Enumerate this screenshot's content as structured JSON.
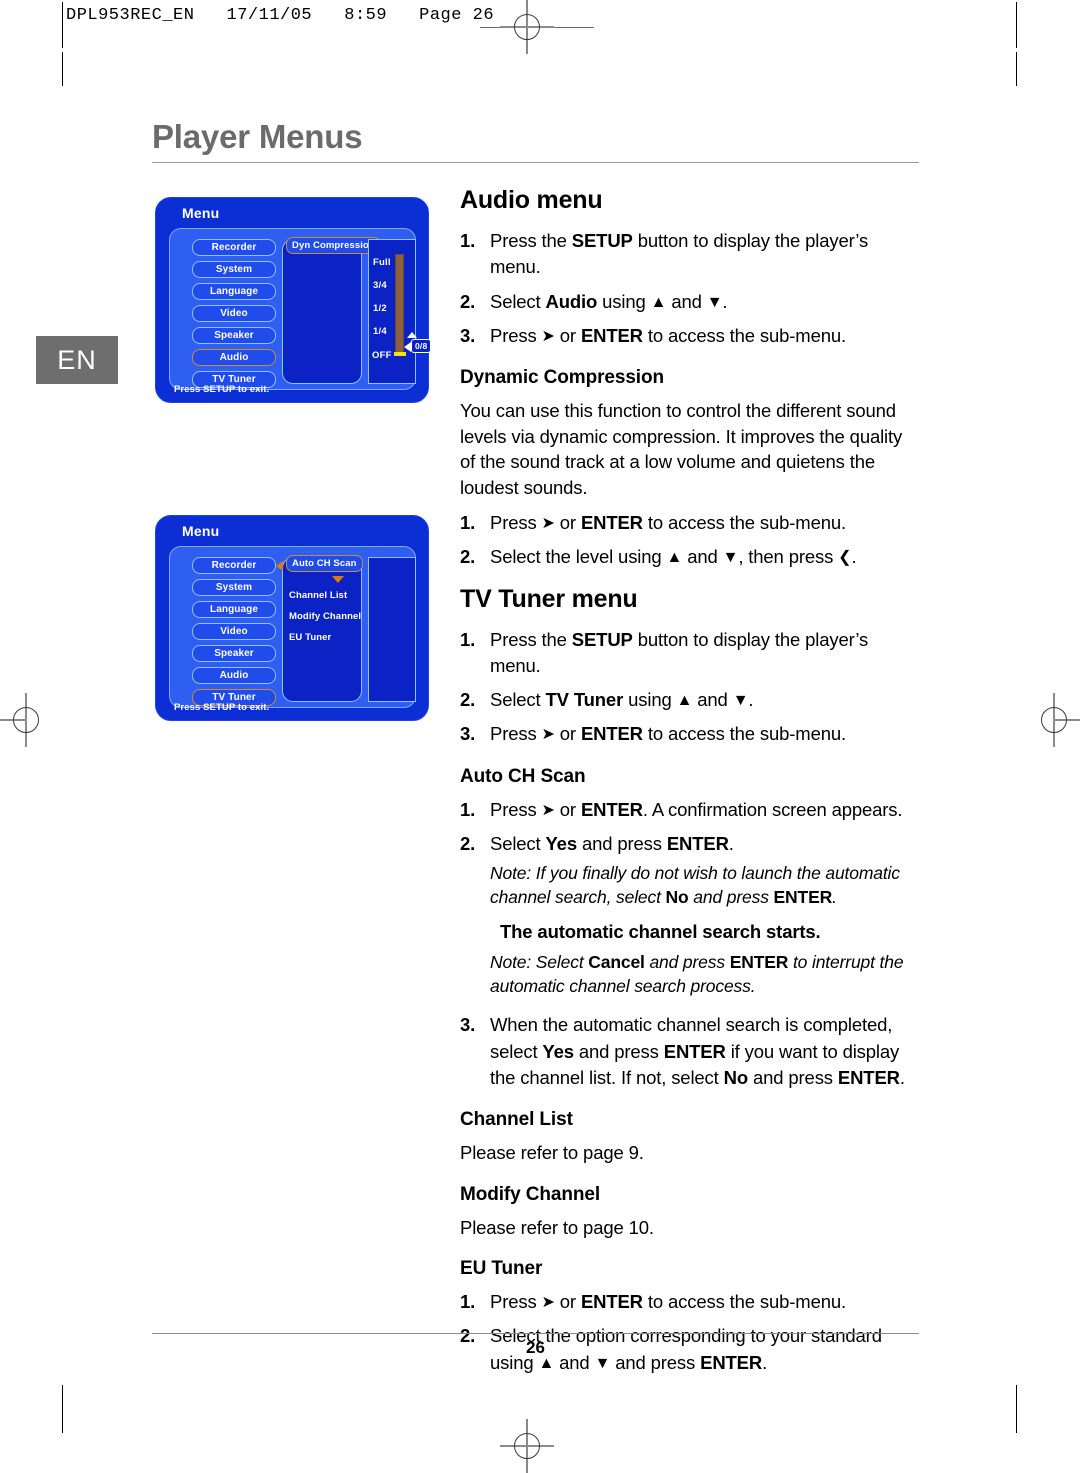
{
  "print_header": {
    "text": "DPL953REC_EN   17/11/05   8:59   Page 26"
  },
  "language_tab": {
    "label": "EN"
  },
  "page_title": "Player Menus",
  "folio": "26",
  "osd_audio": {
    "title": "Menu",
    "exit_hint": "Press SETUP to exit.",
    "nav_items": [
      {
        "label": "Recorder",
        "selected": false
      },
      {
        "label": "System",
        "selected": false
      },
      {
        "label": "Language",
        "selected": false
      },
      {
        "label": "Video",
        "selected": false
      },
      {
        "label": "Speaker",
        "selected": false
      },
      {
        "label": "Audio",
        "selected": true
      },
      {
        "label": "TV Tuner",
        "selected": false
      }
    ],
    "sub_items": [
      {
        "label": "Dyn Compression",
        "highlighted": true
      }
    ],
    "levels": [
      "Full",
      "3/4",
      "1/2",
      "1/4",
      "OFF"
    ],
    "value_badge": "0/8"
  },
  "osd_tuner": {
    "title": "Menu",
    "exit_hint": "Press SETUP to exit.",
    "nav_items": [
      {
        "label": "Recorder",
        "selected": false
      },
      {
        "label": "System",
        "selected": false
      },
      {
        "label": "Language",
        "selected": false
      },
      {
        "label": "Video",
        "selected": false
      },
      {
        "label": "Speaker",
        "selected": false
      },
      {
        "label": "Audio",
        "selected": false
      },
      {
        "label": "TV Tuner",
        "selected": true
      }
    ],
    "sub_items": [
      {
        "label": "Auto CH Scan",
        "highlighted": true
      },
      {
        "label": "Channel List",
        "highlighted": false
      },
      {
        "label": "Modify Channel",
        "highlighted": false
      },
      {
        "label": "EU Tuner",
        "highlighted": false
      }
    ]
  },
  "audio_menu": {
    "heading": "Audio menu",
    "steps": [
      {
        "num": "1.",
        "html": "Press the <b>SETUP</b> button to display the player’s menu."
      },
      {
        "num": "2.",
        "html": "Select <b>Audio</b> using <span class=\"arr\">▲</span> and <span class=\"arr\">▼</span>."
      },
      {
        "num": "3.",
        "html": "Press <span class=\"arr\">➤</span> or <b>ENTER</b> to access the sub-menu."
      }
    ]
  },
  "dynamic_compression": {
    "heading": "Dynamic Compression",
    "paragraph": "You can use this function to control the different sound levels via dynamic compression. It improves the quality of the sound track at a low volume and quietens the loudest sounds.",
    "steps": [
      {
        "num": "1.",
        "html": "Press <span class=\"arr\">➤</span> or <b>ENTER</b> to access the sub-menu."
      },
      {
        "num": "2.",
        "html": "Select the level using <span class=\"arr\">▲</span> and <span class=\"arr\">▼</span>, then press <span class=\"arr\">❮</span>."
      }
    ]
  },
  "tv_tuner_menu": {
    "heading": "TV Tuner menu",
    "steps": [
      {
        "num": "1.",
        "html": "Press the <b>SETUP</b> button to display the player’s menu."
      },
      {
        "num": "2.",
        "html": "Select <b>TV Tuner</b> using <span class=\"arr\">▲</span> and <span class=\"arr\">▼</span>."
      },
      {
        "num": "3.",
        "html": "Press <span class=\"arr\">➤</span> or <b>ENTER</b> to access the sub-menu."
      }
    ]
  },
  "auto_ch_scan": {
    "heading": "Auto CH Scan",
    "step1": {
      "num": "1.",
      "html": "Press <span class=\"arr\">➤</span> or <b>ENTER</b>. A confirmation screen appears."
    },
    "step2": {
      "num": "2.",
      "html": "Select <b>Yes</b> and press <b>ENTER</b>."
    },
    "note1": "Note: If you finally do not wish to launch the automatic channel search, select <b>No</b> and press <b>ENTER</b>.",
    "result": "The automatic channel search starts.",
    "note2": "Note: Select <b>Cancel</b> and press <b>ENTER</b> to interrupt the automatic channel search process.",
    "step3": {
      "num": "3.",
      "html": "When the automatic channel search is completed, select <b>Yes</b> and press <b>ENTER</b> if you want to display the channel list. If not, select <b>No</b> and press <b>ENTER</b>."
    }
  },
  "channel_list": {
    "heading": "Channel List",
    "body": "Please refer to page 9."
  },
  "modify_channel": {
    "heading": "Modify Channel",
    "body": "Please refer to page 10."
  },
  "eu_tuner": {
    "heading": "EU Tuner",
    "steps": [
      {
        "num": "1.",
        "html": "Press <span class=\"arr\">➤</span> or <b>ENTER</b> to access the sub-menu."
      },
      {
        "num": "2.",
        "html": "Select the option corresponding to your standard using <span class=\"arr\">▲</span> and <span class=\"arr\">▼</span> and press <b>ENTER</b>."
      }
    ]
  }
}
